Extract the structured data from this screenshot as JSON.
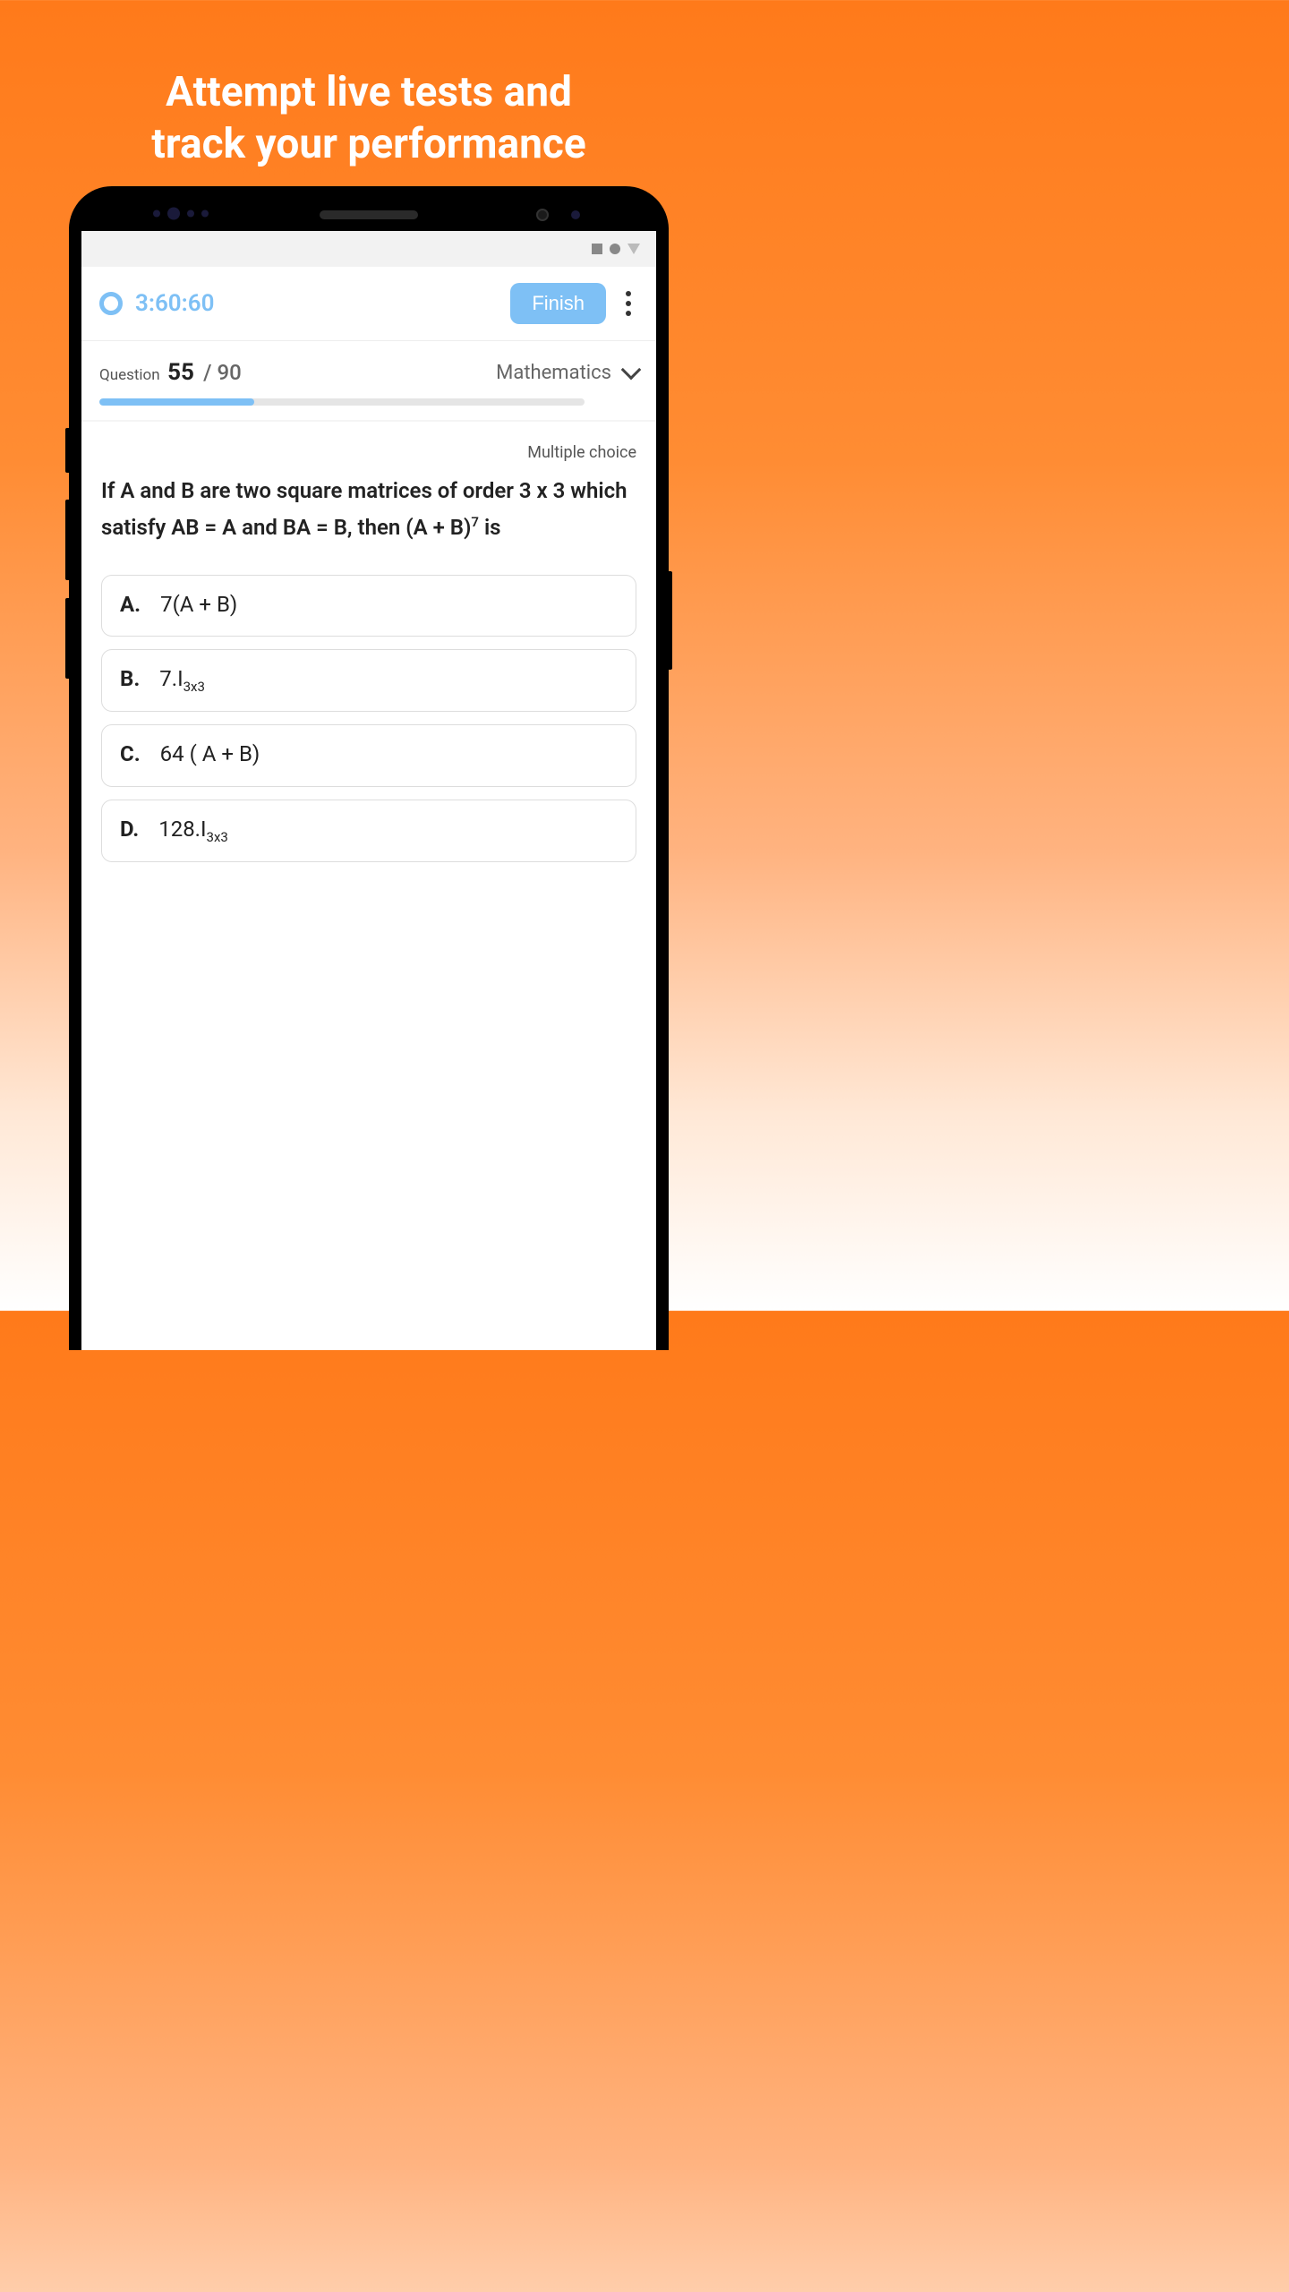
{
  "hero": {
    "line1": "Attempt live tests and",
    "line2": "track your performance"
  },
  "header": {
    "timer": "3:60:60",
    "finish_label": "Finish"
  },
  "progress": {
    "question_label": "Question",
    "current": "55",
    "separator": "/",
    "total": "90",
    "subject": "Mathematics",
    "percent": 32
  },
  "question": {
    "type_label": "Multiple choice",
    "text_prefix": "If A and B are two square matrices of order 3 x 3 which satisfy AB = A and BA = B, then (A + B)",
    "text_exponent": "7",
    "text_suffix": " is"
  },
  "options": [
    {
      "letter": "A.",
      "text": "7(A + B)",
      "sub": ""
    },
    {
      "letter": "B.",
      "text": "7.I",
      "sub": "3x3"
    },
    {
      "letter": "C.",
      "text": "64 ( A + B)",
      "sub": ""
    },
    {
      "letter": "D.",
      "text": "128.I",
      "sub": "3x3"
    }
  ]
}
